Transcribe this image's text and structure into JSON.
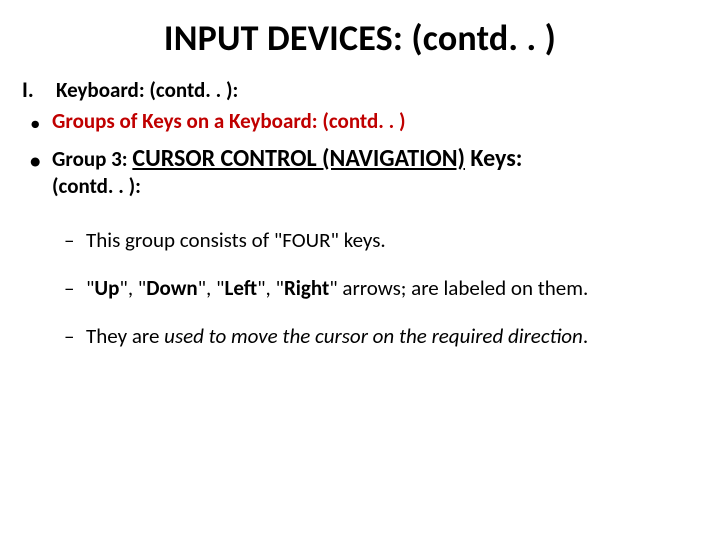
{
  "title": "INPUT DEVICES: (contd. . )",
  "heading": {
    "roman": "I.",
    "text": "Keyboard: (contd. . ):"
  },
  "bullet1": {
    "dot": "•",
    "text": "Groups of Keys on a Keyboard: (contd. . )"
  },
  "bullet2": {
    "dot": "•",
    "lead": "Group 3:  ",
    "main": "CURSOR CONTROL (NAVIGATION)",
    "trail": " Keys: ",
    "cont": "(contd. . ):"
  },
  "items": {
    "dash": "–",
    "i1": {
      "a": "This group consists of ",
      "b": "\"FOUR\"",
      "c": " keys."
    },
    "i2": {
      "a": "\"",
      "up": "Up",
      "b": "\", \"",
      "down": "Down",
      "c": "\", \"",
      "left": "Left",
      "d": "\", \"",
      "right": "Right",
      "e": "\" arrows; are labeled on them."
    },
    "i3": {
      "a": "They are ",
      "b": "used to move the cursor on the required direction",
      "c": "."
    }
  }
}
